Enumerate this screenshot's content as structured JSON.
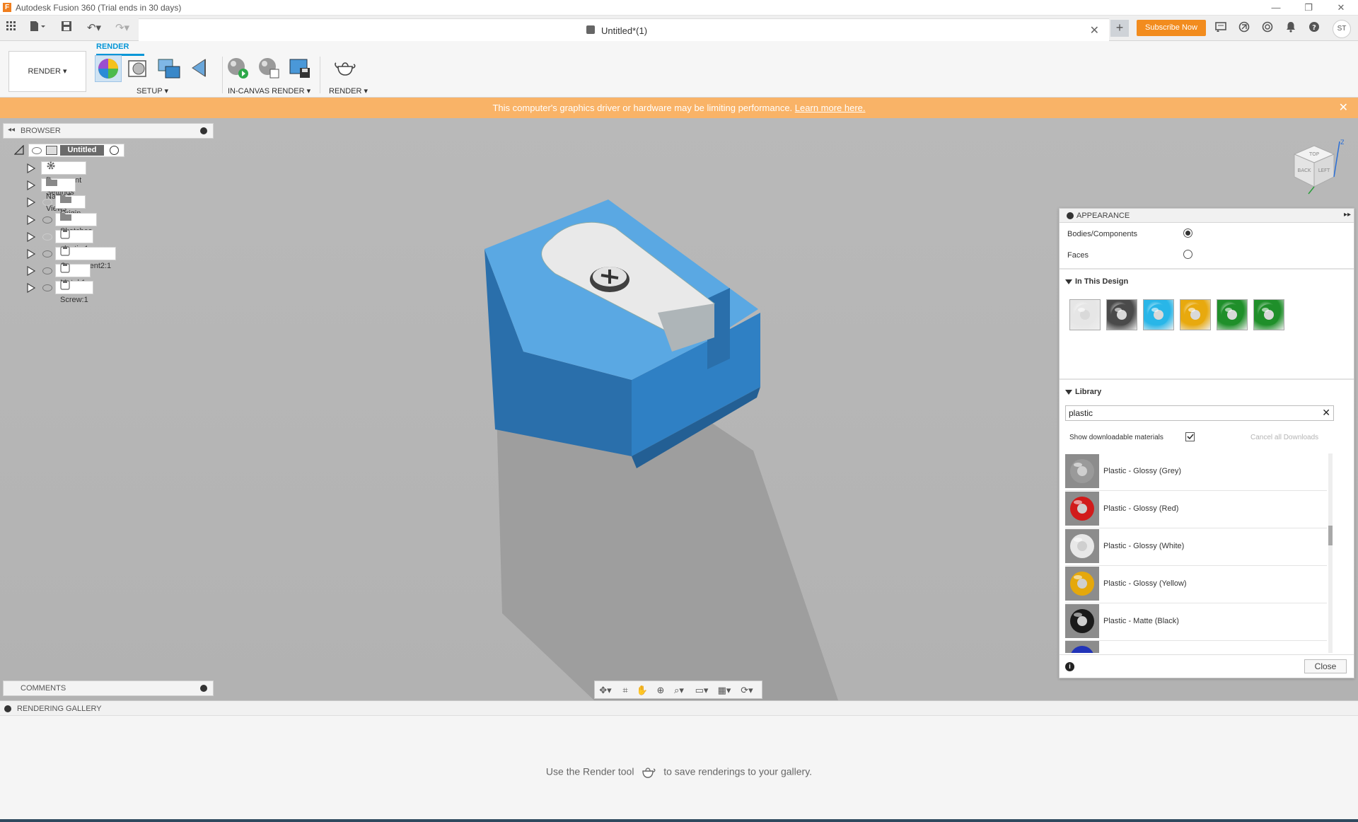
{
  "window": {
    "title": "Autodesk Fusion 360 (Trial ends in 30 days)",
    "app_icon_letter": "F",
    "minimize": "—",
    "maximize": "❐",
    "close": "✕"
  },
  "tabs": {
    "document_title": "Untitled*(1)",
    "close_label": "✕",
    "new_tab_label": "+",
    "subscribe_label": "Subscribe Now",
    "user_initials": "ST"
  },
  "ribbon": {
    "active_tab": "RENDER",
    "workspace_label": "RENDER ▾",
    "groups": [
      {
        "label": "SETUP ▾"
      },
      {
        "label": "IN-CANVAS RENDER ▾"
      },
      {
        "label": "RENDER ▾"
      }
    ]
  },
  "warning": {
    "text": "This computer's graphics driver or hardware may be limiting performance.",
    "link": "Learn more here."
  },
  "browser": {
    "title": "BROWSER",
    "root": "Untitled",
    "items": [
      {
        "label": "Document Settings",
        "icon": "gear-icon",
        "visible": null
      },
      {
        "label": "Named Views",
        "icon": "folder-icon",
        "visible": null
      },
      {
        "label": "Origin",
        "icon": "folder-icon",
        "visible": false
      },
      {
        "label": "Sketches",
        "icon": "folder-icon",
        "visible": true
      },
      {
        "label": "plastic:1",
        "icon": "component-icon",
        "visible": false
      },
      {
        "label": "Component2:1",
        "icon": "component-icon",
        "visible": true
      },
      {
        "label": "Metal:1",
        "icon": "component-icon",
        "visible": true
      },
      {
        "label": "Screw:1",
        "icon": "component-icon",
        "visible": true
      }
    ]
  },
  "appearance": {
    "title": "APPEARANCE",
    "apply_to": [
      {
        "label": "Bodies/Components",
        "selected": true
      },
      {
        "label": "Faces",
        "selected": false
      }
    ],
    "in_design_title": "In This Design",
    "in_design_swatches": [
      "#e6e6e6",
      "#4a4a4a",
      "#29b6e8",
      "#e8a90e",
      "#1f8f2a",
      "#1f8f2a"
    ],
    "library_title": "Library",
    "search_value": "plastic",
    "show_downloadable": "Show downloadable materials",
    "cancel_downloads": "Cancel all Downloads",
    "materials": [
      {
        "name": "Plastic - Glossy (Grey)",
        "color": "#9a9a9a"
      },
      {
        "name": "Plastic - Glossy (Red)",
        "color": "#d11b1b"
      },
      {
        "name": "Plastic - Glossy (White)",
        "color": "#e8e8e8"
      },
      {
        "name": "Plastic - Glossy (Yellow)",
        "color": "#e5a80c"
      },
      {
        "name": "Plastic - Matte (Black)",
        "color": "#1a1a1a"
      }
    ],
    "close_label": "Close"
  },
  "comments": {
    "title": "COMMENTS"
  },
  "gallery": {
    "title": "RENDERING GALLERY",
    "message_before": "Use the Render tool",
    "message_after": "to save renderings to your gallery."
  },
  "viewcube": {
    "top": "TOP",
    "front": "LEFT",
    "right": "BACK",
    "axis_z": "Z"
  },
  "colors": {
    "accent": "#0696d7",
    "warning": "#f9b367",
    "subscribe": "#f28c1e",
    "model_blue": "#2f80c4"
  }
}
